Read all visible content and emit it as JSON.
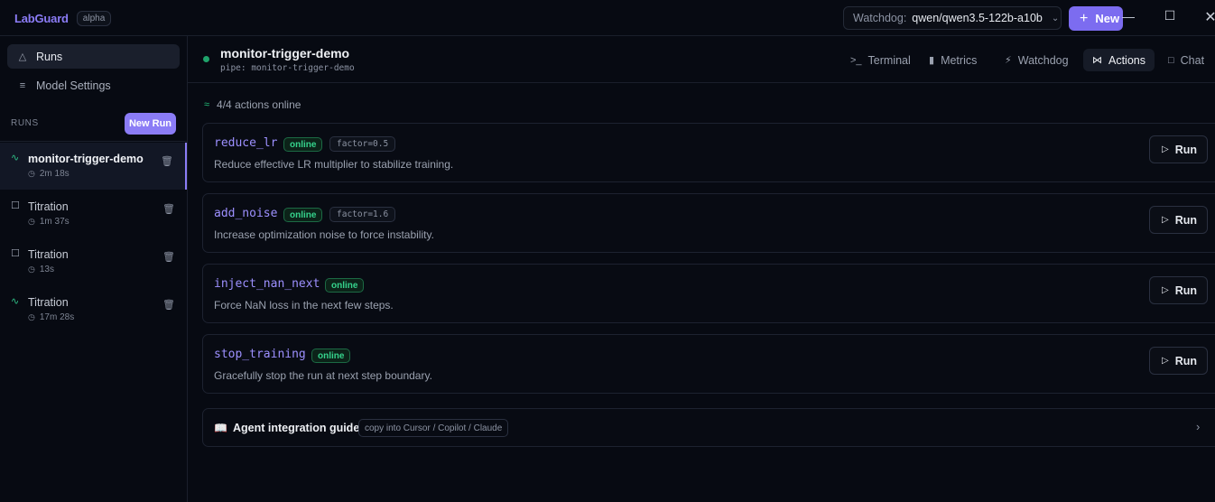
{
  "app": {
    "name": "LabGuard",
    "badge": "alpha"
  },
  "topbar": {
    "watchdog_label": "Watchdog:",
    "watchdog_value": "qwen/qwen3.5-122b-a10b",
    "new_button_label": "New",
    "window_controls": [
      "minimize-icon",
      "maximize-icon",
      "close-icon"
    ]
  },
  "sidebar": {
    "nav": [
      {
        "label": "Runs",
        "icon": "flask-icon",
        "active": true
      },
      {
        "label": "Model Settings",
        "icon": "sliders-icon",
        "active": false
      }
    ],
    "runs_heading": "RUNS",
    "new_run_label": "New Run",
    "runs": [
      {
        "title": "monitor-trigger-demo",
        "duration": "2m 18s",
        "status_icon": "activity-icon",
        "active": true
      },
      {
        "title": "Titration",
        "duration": "1m 37s",
        "status_icon": "square-icon",
        "active": false
      },
      {
        "title": "Titration",
        "duration": "13s",
        "status_icon": "square-icon",
        "active": false
      },
      {
        "title": "Titration",
        "duration": "17m 28s",
        "status_icon": "activity-icon",
        "active": false
      }
    ]
  },
  "main": {
    "run_title": "monitor-trigger-demo",
    "pipe": "pipe: monitor-trigger-demo",
    "tabs": [
      {
        "label": "Terminal",
        "icon": "terminal-icon",
        "active": false
      },
      {
        "label": "Metrics",
        "icon": "bar-chart-icon",
        "active": false
      },
      {
        "label": "Watchdog",
        "icon": "zap-icon",
        "active": false
      },
      {
        "label": "Actions",
        "icon": "plug-icon",
        "active": true
      },
      {
        "label": "Chat",
        "icon": "message-icon",
        "active": false
      }
    ],
    "online_summary": "4/4 actions online",
    "actions": [
      {
        "name": "reduce_lr",
        "status": "online",
        "param": "factor=0.5",
        "description": "Reduce effective LR multiplier to stabilize training.",
        "run_label": "Run"
      },
      {
        "name": "add_noise",
        "status": "online",
        "param": "factor=1.6",
        "description": "Increase optimization noise to force instability.",
        "run_label": "Run"
      },
      {
        "name": "inject_nan_next",
        "status": "online",
        "param": "",
        "description": "Force NaN loss in the next few steps.",
        "run_label": "Run"
      },
      {
        "name": "stop_training",
        "status": "online",
        "param": "",
        "description": "Gracefully stop the run at next step boundary.",
        "run_label": "Run"
      }
    ],
    "guide": {
      "title": "Agent integration guide",
      "tag": "copy into Cursor / Copilot / Claude"
    }
  },
  "colors": {
    "accent": "#8b7cf6",
    "online": "#35d38c",
    "background": "#070a12"
  }
}
